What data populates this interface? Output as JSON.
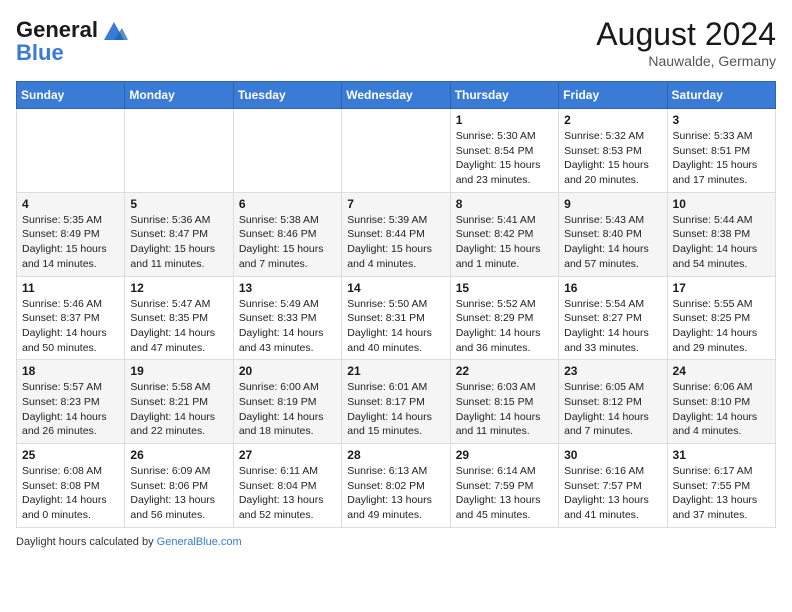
{
  "header": {
    "logo_text_general": "General",
    "logo_text_blue": "Blue",
    "month_year": "August 2024",
    "location": "Nauwalde, Germany"
  },
  "weekdays": [
    "Sunday",
    "Monday",
    "Tuesday",
    "Wednesday",
    "Thursday",
    "Friday",
    "Saturday"
  ],
  "weeks": [
    [
      {
        "day": "",
        "info": ""
      },
      {
        "day": "",
        "info": ""
      },
      {
        "day": "",
        "info": ""
      },
      {
        "day": "",
        "info": ""
      },
      {
        "day": "1",
        "info": "Sunrise: 5:30 AM\nSunset: 8:54 PM\nDaylight: 15 hours\nand 23 minutes."
      },
      {
        "day": "2",
        "info": "Sunrise: 5:32 AM\nSunset: 8:53 PM\nDaylight: 15 hours\nand 20 minutes."
      },
      {
        "day": "3",
        "info": "Sunrise: 5:33 AM\nSunset: 8:51 PM\nDaylight: 15 hours\nand 17 minutes."
      }
    ],
    [
      {
        "day": "4",
        "info": "Sunrise: 5:35 AM\nSunset: 8:49 PM\nDaylight: 15 hours\nand 14 minutes."
      },
      {
        "day": "5",
        "info": "Sunrise: 5:36 AM\nSunset: 8:47 PM\nDaylight: 15 hours\nand 11 minutes."
      },
      {
        "day": "6",
        "info": "Sunrise: 5:38 AM\nSunset: 8:46 PM\nDaylight: 15 hours\nand 7 minutes."
      },
      {
        "day": "7",
        "info": "Sunrise: 5:39 AM\nSunset: 8:44 PM\nDaylight: 15 hours\nand 4 minutes."
      },
      {
        "day": "8",
        "info": "Sunrise: 5:41 AM\nSunset: 8:42 PM\nDaylight: 15 hours\nand 1 minute."
      },
      {
        "day": "9",
        "info": "Sunrise: 5:43 AM\nSunset: 8:40 PM\nDaylight: 14 hours\nand 57 minutes."
      },
      {
        "day": "10",
        "info": "Sunrise: 5:44 AM\nSunset: 8:38 PM\nDaylight: 14 hours\nand 54 minutes."
      }
    ],
    [
      {
        "day": "11",
        "info": "Sunrise: 5:46 AM\nSunset: 8:37 PM\nDaylight: 14 hours\nand 50 minutes."
      },
      {
        "day": "12",
        "info": "Sunrise: 5:47 AM\nSunset: 8:35 PM\nDaylight: 14 hours\nand 47 minutes."
      },
      {
        "day": "13",
        "info": "Sunrise: 5:49 AM\nSunset: 8:33 PM\nDaylight: 14 hours\nand 43 minutes."
      },
      {
        "day": "14",
        "info": "Sunrise: 5:50 AM\nSunset: 8:31 PM\nDaylight: 14 hours\nand 40 minutes."
      },
      {
        "day": "15",
        "info": "Sunrise: 5:52 AM\nSunset: 8:29 PM\nDaylight: 14 hours\nand 36 minutes."
      },
      {
        "day": "16",
        "info": "Sunrise: 5:54 AM\nSunset: 8:27 PM\nDaylight: 14 hours\nand 33 minutes."
      },
      {
        "day": "17",
        "info": "Sunrise: 5:55 AM\nSunset: 8:25 PM\nDaylight: 14 hours\nand 29 minutes."
      }
    ],
    [
      {
        "day": "18",
        "info": "Sunrise: 5:57 AM\nSunset: 8:23 PM\nDaylight: 14 hours\nand 26 minutes."
      },
      {
        "day": "19",
        "info": "Sunrise: 5:58 AM\nSunset: 8:21 PM\nDaylight: 14 hours\nand 22 minutes."
      },
      {
        "day": "20",
        "info": "Sunrise: 6:00 AM\nSunset: 8:19 PM\nDaylight: 14 hours\nand 18 minutes."
      },
      {
        "day": "21",
        "info": "Sunrise: 6:01 AM\nSunset: 8:17 PM\nDaylight: 14 hours\nand 15 minutes."
      },
      {
        "day": "22",
        "info": "Sunrise: 6:03 AM\nSunset: 8:15 PM\nDaylight: 14 hours\nand 11 minutes."
      },
      {
        "day": "23",
        "info": "Sunrise: 6:05 AM\nSunset: 8:12 PM\nDaylight: 14 hours\nand 7 minutes."
      },
      {
        "day": "24",
        "info": "Sunrise: 6:06 AM\nSunset: 8:10 PM\nDaylight: 14 hours\nand 4 minutes."
      }
    ],
    [
      {
        "day": "25",
        "info": "Sunrise: 6:08 AM\nSunset: 8:08 PM\nDaylight: 14 hours\nand 0 minutes."
      },
      {
        "day": "26",
        "info": "Sunrise: 6:09 AM\nSunset: 8:06 PM\nDaylight: 13 hours\nand 56 minutes."
      },
      {
        "day": "27",
        "info": "Sunrise: 6:11 AM\nSunset: 8:04 PM\nDaylight: 13 hours\nand 52 minutes."
      },
      {
        "day": "28",
        "info": "Sunrise: 6:13 AM\nSunset: 8:02 PM\nDaylight: 13 hours\nand 49 minutes."
      },
      {
        "day": "29",
        "info": "Sunrise: 6:14 AM\nSunset: 7:59 PM\nDaylight: 13 hours\nand 45 minutes."
      },
      {
        "day": "30",
        "info": "Sunrise: 6:16 AM\nSunset: 7:57 PM\nDaylight: 13 hours\nand 41 minutes."
      },
      {
        "day": "31",
        "info": "Sunrise: 6:17 AM\nSunset: 7:55 PM\nDaylight: 13 hours\nand 37 minutes."
      }
    ]
  ],
  "footer": {
    "daylight_label": "Daylight hours"
  }
}
